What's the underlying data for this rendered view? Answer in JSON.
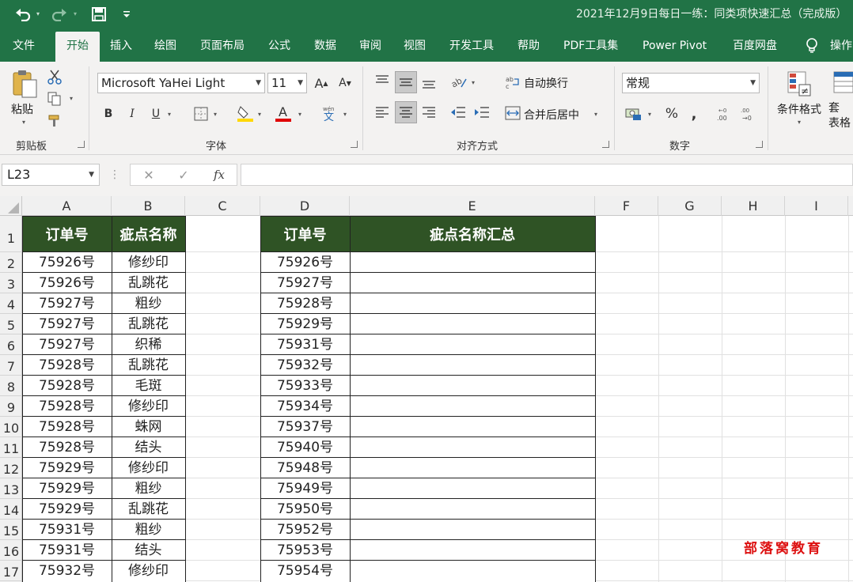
{
  "window": {
    "title": "2021年12月9日每日一练：同类项快速汇总（完成版）",
    "undo_icon": "undo-icon",
    "redo_icon": "redo-icon",
    "save_icon": "save-icon"
  },
  "tabs": [
    "文件",
    "开始",
    "插入",
    "绘图",
    "页面布局",
    "公式",
    "数据",
    "审阅",
    "视图",
    "开发工具",
    "帮助",
    "PDF工具集",
    "Power Pivot",
    "百度网盘",
    "操作"
  ],
  "active_tab": "开始",
  "ribbon": {
    "clipboard": {
      "label": "剪贴板",
      "paste": "粘贴"
    },
    "font": {
      "label": "字体",
      "name": "Microsoft YaHei Light",
      "size": "11",
      "bold": "B",
      "italic": "I",
      "underline": "U",
      "font_color": "#e00000",
      "fill_color": "#ffd800"
    },
    "alignment": {
      "label": "对齐方式",
      "wrap_text": "自动换行",
      "merge_center": "合并后居中"
    },
    "number": {
      "label": "数字",
      "format": "常规"
    },
    "styles": {
      "conditional_format": "条件格式",
      "table_format_partial": "套\n表格"
    }
  },
  "formula_bar": {
    "name_box": "L23",
    "fx": "fx",
    "formula": ""
  },
  "columns": [
    "A",
    "B",
    "C",
    "D",
    "E",
    "F",
    "G",
    "H",
    "I"
  ],
  "rows": [
    "1",
    "2",
    "3",
    "4",
    "5",
    "6",
    "7",
    "8",
    "9",
    "10",
    "11",
    "12",
    "13",
    "14",
    "15",
    "16",
    "17"
  ],
  "sheet": {
    "left_table": {
      "headers": [
        "订单号",
        "疵点名称"
      ],
      "rows": [
        [
          "75926号",
          "修纱印"
        ],
        [
          "75926号",
          "乱跳花"
        ],
        [
          "75927号",
          "粗纱"
        ],
        [
          "75927号",
          "乱跳花"
        ],
        [
          "75927号",
          "织稀"
        ],
        [
          "75928号",
          "乱跳花"
        ],
        [
          "75928号",
          "毛斑"
        ],
        [
          "75928号",
          "修纱印"
        ],
        [
          "75928号",
          "蛛网"
        ],
        [
          "75928号",
          "结头"
        ],
        [
          "75929号",
          "修纱印"
        ],
        [
          "75929号",
          "粗纱"
        ],
        [
          "75929号",
          "乱跳花"
        ],
        [
          "75931号",
          "粗纱"
        ],
        [
          "75931号",
          "结头"
        ],
        [
          "75932号",
          "修纱印"
        ]
      ]
    },
    "right_table": {
      "headers": [
        "订单号",
        "疵点名称汇总"
      ],
      "rows": [
        [
          "75926号",
          ""
        ],
        [
          "75927号",
          ""
        ],
        [
          "75928号",
          ""
        ],
        [
          "75929号",
          ""
        ],
        [
          "75931号",
          ""
        ],
        [
          "75932号",
          ""
        ],
        [
          "75933号",
          ""
        ],
        [
          "75934号",
          ""
        ],
        [
          "75937号",
          ""
        ],
        [
          "75940号",
          ""
        ],
        [
          "75948号",
          ""
        ],
        [
          "75949号",
          ""
        ],
        [
          "75950号",
          ""
        ],
        [
          "75952号",
          ""
        ],
        [
          "75953号",
          ""
        ],
        [
          "75954号",
          ""
        ]
      ]
    },
    "header_fill": "#2f5325"
  },
  "watermark": "部落窝教育"
}
